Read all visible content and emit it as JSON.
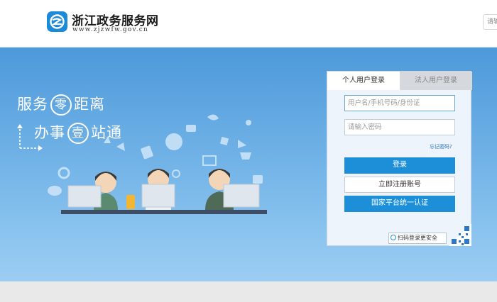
{
  "header": {
    "site_title": "浙江政务服务网",
    "site_url": "www.zjzwfw.gov.cn",
    "search_placeholder": "请输"
  },
  "banner": {
    "slogan_line1_part1": "服务",
    "slogan_line1_circle": "零",
    "slogan_line1_part2": "距离",
    "slogan_line2_part1": "办事",
    "slogan_line2_circle": "壹",
    "slogan_line2_part2": "站通"
  },
  "login": {
    "tab_personal": "个人用户登录",
    "tab_legal": "法人用户登录",
    "username_placeholder": "用户名/手机号码/身份证",
    "password_placeholder": "请输入密码",
    "forgot_password": "忘记密码?",
    "login_button": "登录",
    "register_button": "立即注册账号",
    "national_auth_button": "国家平台统一认证",
    "qr_tip": "扫码登录更安全",
    "active_tab": "个人用户登录"
  },
  "colors": {
    "brand_blue": "#1d8fd8",
    "banner_top": "#4d99da",
    "banner_bottom": "#9ccdf2"
  },
  "icons": [
    "logo-icon",
    "arrow-up-right-icon",
    "qr-scan-icon",
    "qr-code-icon"
  ]
}
